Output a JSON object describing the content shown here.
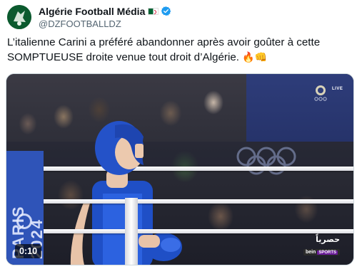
{
  "account": {
    "display_name": "Algérie Football Média",
    "handle": "@DZFOOTBALLDZ",
    "avatar_icon": "green-circle-logo",
    "flag_icon": "algeria-flag-icon",
    "verified_icon": "verified-badge-icon",
    "verified_color": "#1d9bf0"
  },
  "tweet": {
    "text_line1": "L’italienne Carini a préféré abandonner après avoir goûter à cette",
    "text_line2": "SOMPTUEUSE droite venue tout droit d’Algérie.",
    "emojis": "🔥👊"
  },
  "media": {
    "duration": "0:10",
    "watermark_arabic": "حصرياً",
    "watermark_brand": "bein",
    "watermark_brand_sub": "SPORTS",
    "live_label": "LIVE",
    "side_banner_text": "PARIS 2024",
    "play_icon": "video-player"
  },
  "colors": {
    "text_primary": "#0f1419",
    "text_secondary": "#536471",
    "avatar_bg": "#0b5a2e",
    "boxer_helmet": "#2452c8"
  }
}
